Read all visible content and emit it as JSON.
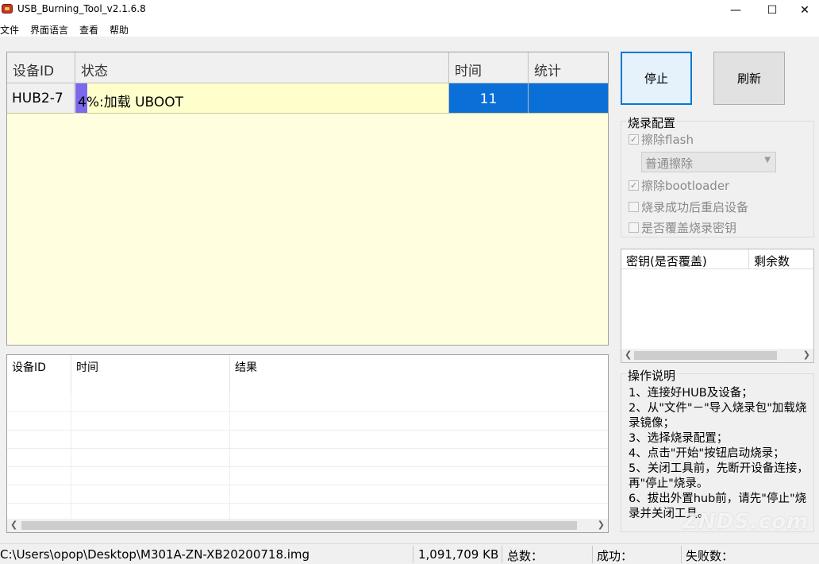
{
  "window": {
    "title": "USB_Burning_Tool_v2.1.6.8",
    "min_glyph": "—",
    "max_glyph": "☐",
    "close_glyph": "✕"
  },
  "menu": [
    "文件",
    "界面语言",
    "查看",
    "帮助"
  ],
  "device_table": {
    "headers": [
      "设备ID",
      "状态",
      "时间",
      "统计"
    ],
    "rows": [
      {
        "id": "HUB2-7",
        "progress": 4,
        "status": "4%:加载 UBOOT",
        "time": "11",
        "stats": ""
      }
    ]
  },
  "result_table": {
    "headers": [
      "设备ID",
      "时间",
      "结果"
    ],
    "rows": []
  },
  "buttons": {
    "stop": "停止",
    "refresh": "刷新"
  },
  "config": {
    "title": "烧录配置",
    "erase_flash": {
      "label": "擦除flash",
      "checked": true
    },
    "erase_mode": "普通擦除",
    "erase_bootloader": {
      "label": "擦除bootloader",
      "checked": true
    },
    "reboot_after": {
      "label": "烧录成功后重启设备",
      "checked": false
    },
    "overwrite_key": {
      "label": "是否覆盖烧录密钥",
      "checked": false
    }
  },
  "key_table": {
    "headers": [
      "密钥(是否覆盖)",
      "剩余数"
    ]
  },
  "help": {
    "title": "操作说明",
    "lines": [
      "1、连接好HUB及设备；",
      "2、从\"文件\"－\"导入烧录包\"加载烧录镜像；",
      "3、选择烧录配置；",
      "4、点击\"开始\"按钮启动烧录；",
      "5、关闭工具前，先断开设备连接，再\"停止\"烧录。",
      "6、拔出外置hub前，请先\"停止\"烧录并关闭工具。"
    ]
  },
  "statusbar": {
    "path": "C:\\Users\\opop\\Desktop\\M301A-ZN-XB20200718.img",
    "size": "1,091,709 KB",
    "total": "总数：",
    "success": "成功：",
    "fail": "失败数："
  },
  "watermark": "ZNDS.com",
  "colors": {
    "progress": "#7b68ee",
    "selected": "#0a6fd6",
    "panel_bg": "#ffffe0"
  }
}
